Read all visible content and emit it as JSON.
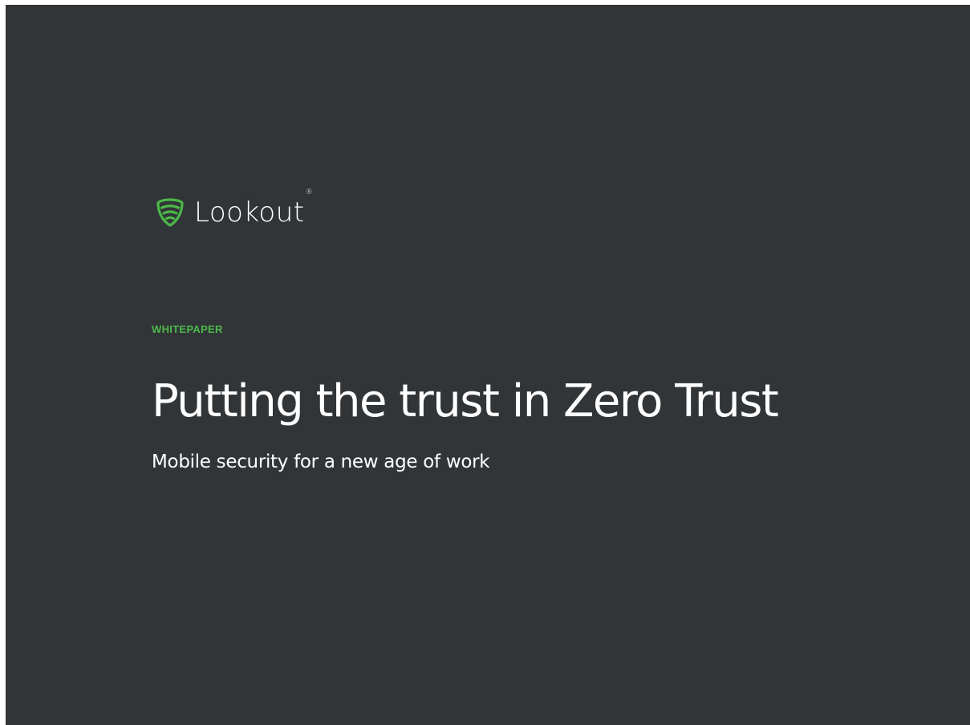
{
  "brand": {
    "name": "Lookout",
    "trademark": "®",
    "logo_icon": "shield-icon",
    "accent_color": "#4cb848"
  },
  "document": {
    "eyebrow": "WHITEPAPER",
    "title": "Putting the trust in Zero Trust",
    "subtitle": "Mobile security for a new age of work"
  },
  "colors": {
    "background": "#323538",
    "text": "#ffffff",
    "accent": "#4cb848"
  }
}
